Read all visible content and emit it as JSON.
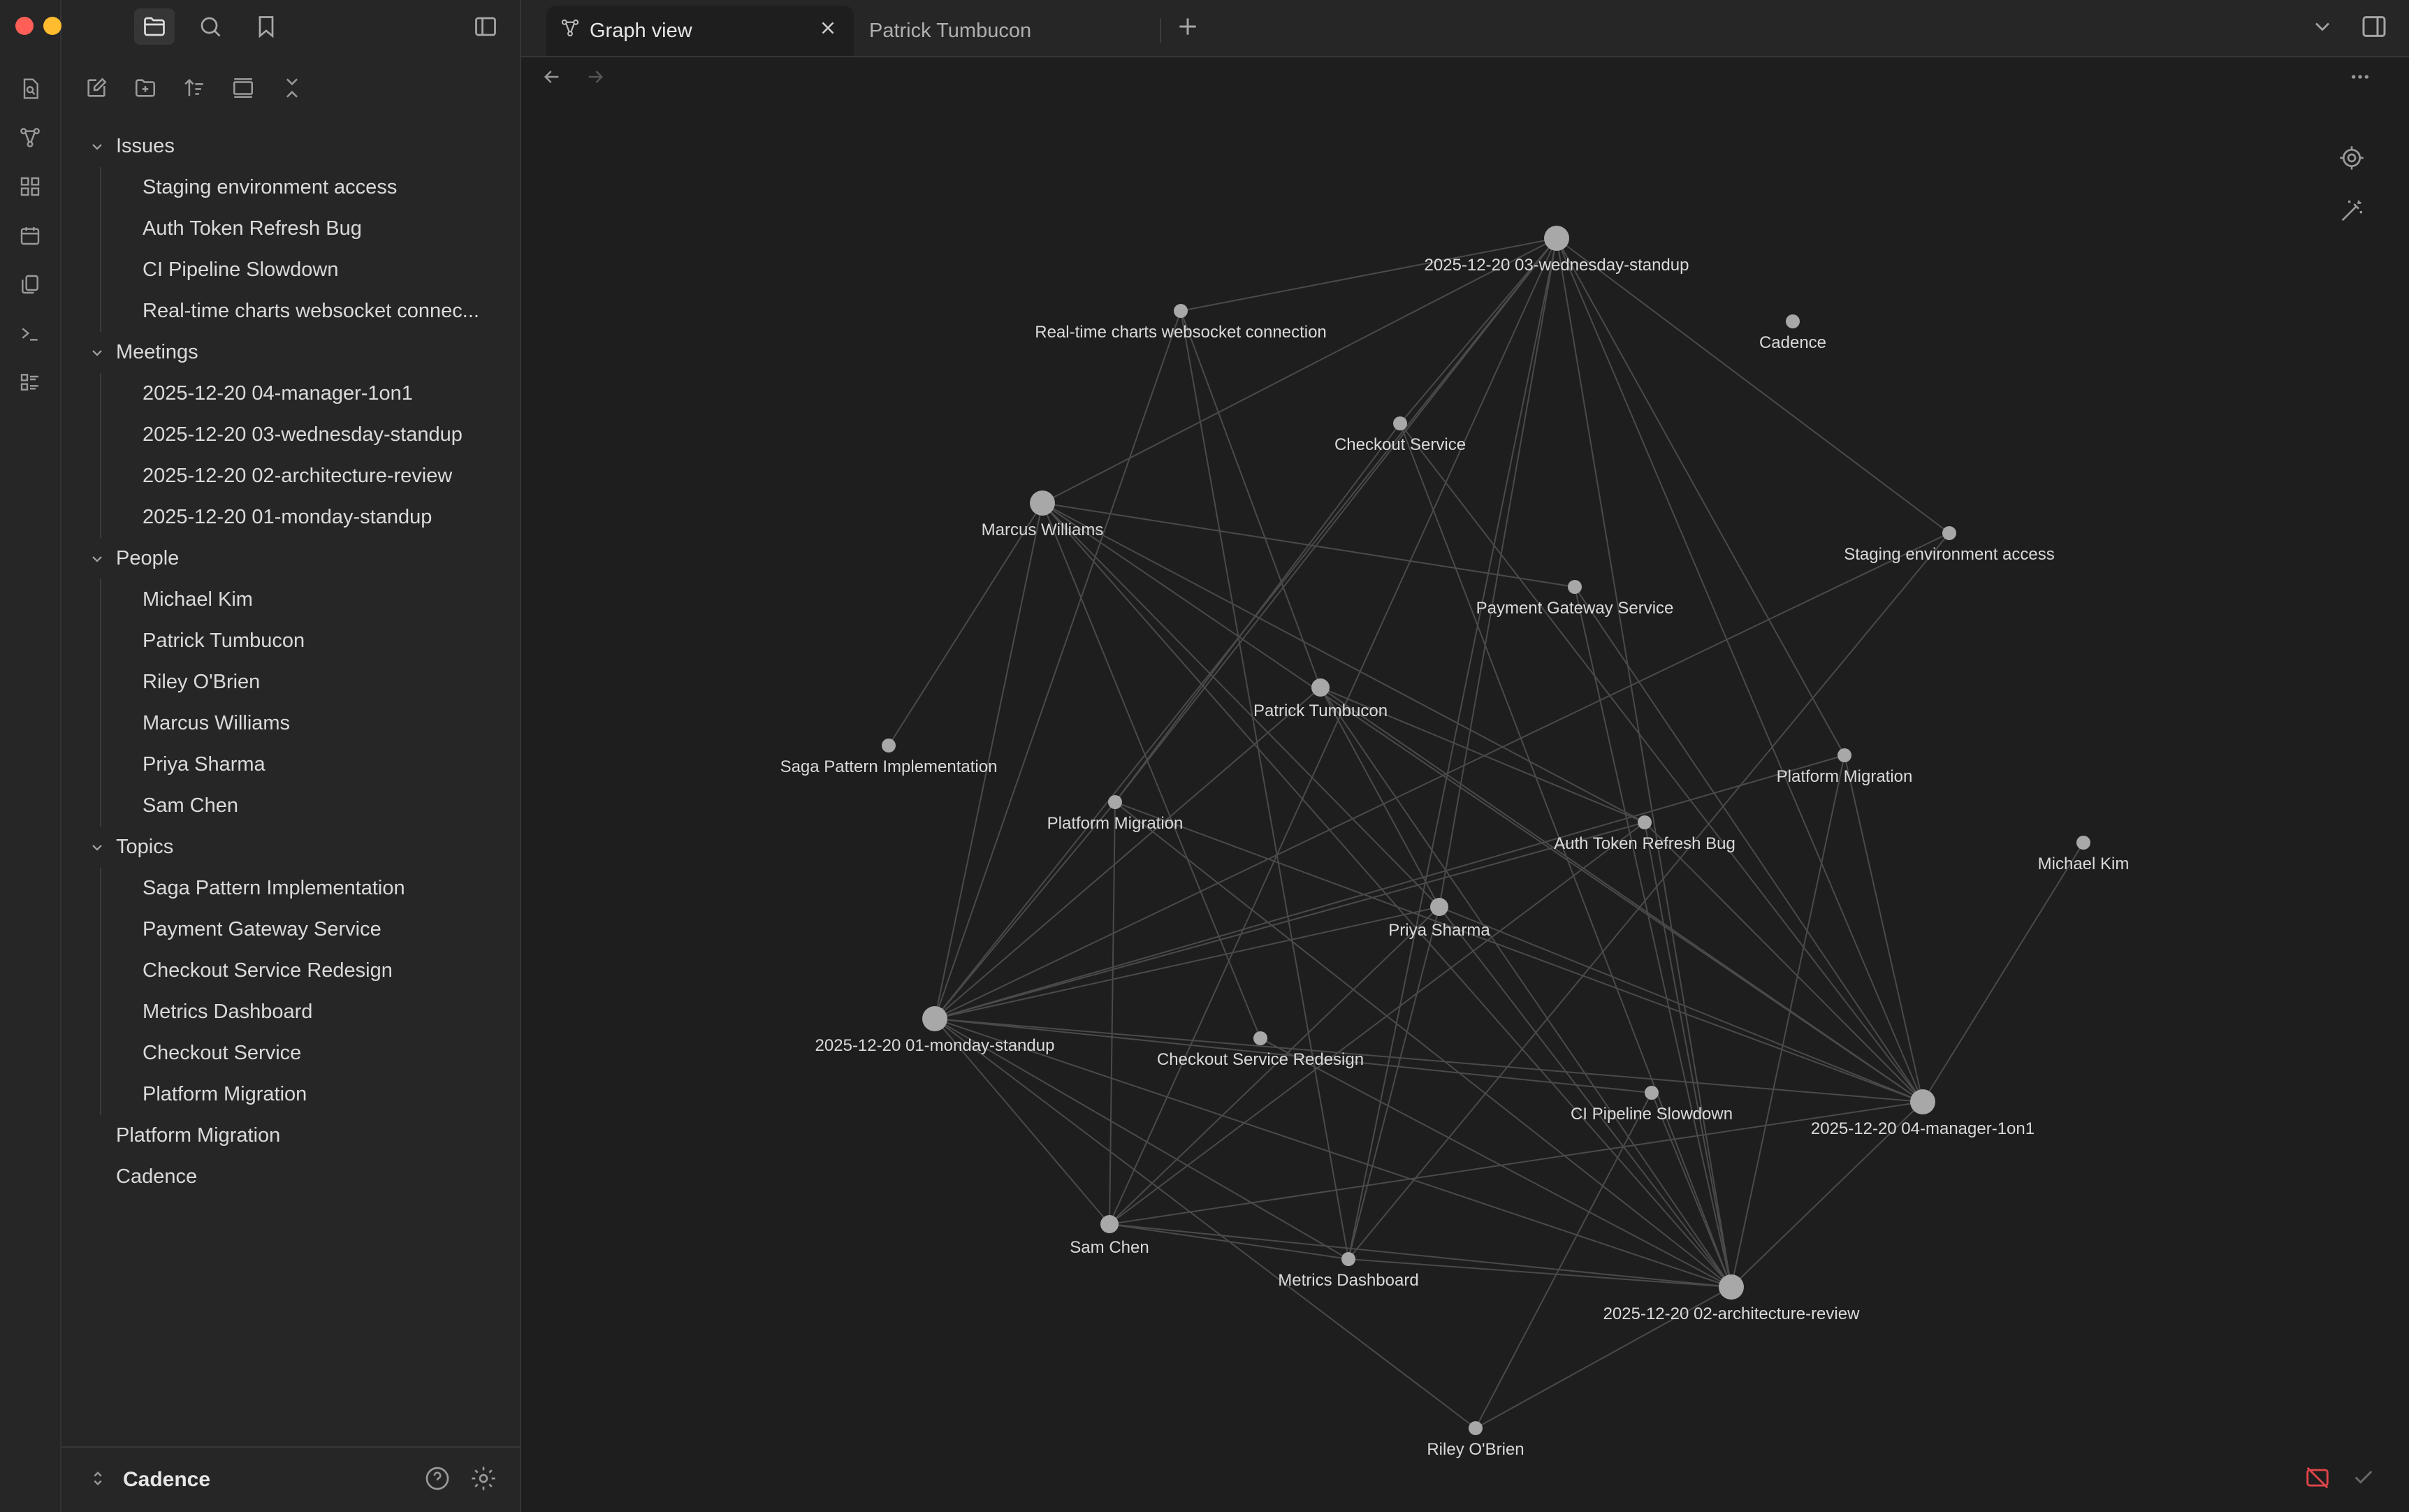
{
  "sidebar": {
    "tree": [
      {
        "type": "folder",
        "label": "Issues",
        "children": [
          "Staging environment access",
          "Auth Token Refresh Bug",
          "CI Pipeline Slowdown",
          "Real-time charts websocket connec..."
        ]
      },
      {
        "type": "folder",
        "label": "Meetings",
        "children": [
          "2025-12-20 04-manager-1on1",
          "2025-12-20 03-wednesday-standup",
          "2025-12-20 02-architecture-review",
          "2025-12-20 01-monday-standup"
        ]
      },
      {
        "type": "folder",
        "label": "People",
        "children": [
          "Michael Kim",
          "Patrick Tumbucon",
          "Riley O'Brien",
          "Marcus Williams",
          "Priya Sharma",
          "Sam Chen"
        ]
      },
      {
        "type": "folder",
        "label": "Topics",
        "children": [
          "Saga Pattern Implementation",
          "Payment Gateway Service",
          "Checkout Service Redesign",
          "Metrics Dashboard",
          "Checkout Service",
          "Platform Migration"
        ]
      },
      {
        "type": "file",
        "label": "Platform Migration"
      },
      {
        "type": "file",
        "label": "Cadence"
      }
    ],
    "vault_name": "Cadence"
  },
  "tabs": [
    {
      "label": "Graph view",
      "active": true
    },
    {
      "label": "Patrick Tumbucon",
      "active": false
    }
  ],
  "graph": {
    "nodes": [
      {
        "id": "wed",
        "label": "2025-12-20 03-wednesday-standup",
        "size": "large"
      },
      {
        "id": "rt",
        "label": "Real-time charts websocket connection",
        "size": "small"
      },
      {
        "id": "cad",
        "label": "Cadence",
        "size": "small"
      },
      {
        "id": "cs",
        "label": "Checkout Service",
        "size": "small"
      },
      {
        "id": "mw",
        "label": "Marcus Williams",
        "size": "large"
      },
      {
        "id": "sea",
        "label": "Staging environment access",
        "size": "small"
      },
      {
        "id": "pgs",
        "label": "Payment Gateway Service",
        "size": "small"
      },
      {
        "id": "pt",
        "label": "Patrick Tumbucon",
        "size": "medium"
      },
      {
        "id": "saga",
        "label": "Saga Pattern Implementation",
        "size": "small"
      },
      {
        "id": "pm1",
        "label": "Platform Migration",
        "size": "small"
      },
      {
        "id": "pm2",
        "label": "Platform Migration",
        "size": "small"
      },
      {
        "id": "atrb",
        "label": "Auth Token Refresh Bug",
        "size": "small"
      },
      {
        "id": "mk",
        "label": "Michael Kim",
        "size": "small"
      },
      {
        "id": "ps",
        "label": "Priya Sharma",
        "size": "medium"
      },
      {
        "id": "mon",
        "label": "2025-12-20 01-monday-standup",
        "size": "large"
      },
      {
        "id": "csr",
        "label": "Checkout Service Redesign",
        "size": "small"
      },
      {
        "id": "cips",
        "label": "CI Pipeline Slowdown",
        "size": "small"
      },
      {
        "id": "mgr",
        "label": "2025-12-20 04-manager-1on1",
        "size": "large"
      },
      {
        "id": "sc",
        "label": "Sam Chen",
        "size": "medium"
      },
      {
        "id": "md",
        "label": "Metrics Dashboard",
        "size": "small"
      },
      {
        "id": "arch",
        "label": "2025-12-20 02-architecture-review",
        "size": "large"
      },
      {
        "id": "rob",
        "label": "Riley O'Brien",
        "size": "small"
      }
    ],
    "edges": [
      [
        "wed",
        "rt"
      ],
      [
        "wed",
        "cs"
      ],
      [
        "wed",
        "mw"
      ],
      [
        "wed",
        "pm2"
      ],
      [
        "wed",
        "sea"
      ],
      [
        "wed",
        "ps"
      ],
      [
        "wed",
        "mon"
      ],
      [
        "wed",
        "sc"
      ],
      [
        "wed",
        "md"
      ],
      [
        "wed",
        "arch"
      ],
      [
        "wed",
        "mgr"
      ],
      [
        "wed",
        "pm1"
      ],
      [
        "rt",
        "pt"
      ],
      [
        "rt",
        "mon"
      ],
      [
        "rt",
        "md"
      ],
      [
        "mw",
        "pgs"
      ],
      [
        "mw",
        "saga"
      ],
      [
        "mw",
        "mon"
      ],
      [
        "mw",
        "atrb"
      ],
      [
        "mw",
        "ps"
      ],
      [
        "mw",
        "mgr"
      ],
      [
        "mw",
        "arch"
      ],
      [
        "mw",
        "csr"
      ],
      [
        "cs",
        "arch"
      ],
      [
        "cs",
        "mgr"
      ],
      [
        "cs",
        "pm1"
      ],
      [
        "sea",
        "mon"
      ],
      [
        "sea",
        "md"
      ],
      [
        "pgs",
        "arch"
      ],
      [
        "pgs",
        "mgr"
      ],
      [
        "pt",
        "atrb"
      ],
      [
        "pt",
        "mgr"
      ],
      [
        "pt",
        "arch"
      ],
      [
        "pt",
        "mon"
      ],
      [
        "pt",
        "ps"
      ],
      [
        "pm1",
        "mon"
      ],
      [
        "pm1",
        "sc"
      ],
      [
        "pm1",
        "arch"
      ],
      [
        "pm1",
        "mgr"
      ],
      [
        "pm2",
        "arch"
      ],
      [
        "pm2",
        "mgr"
      ],
      [
        "pm2",
        "mon"
      ],
      [
        "atrb",
        "mon"
      ],
      [
        "atrb",
        "sc"
      ],
      [
        "atrb",
        "mgr"
      ],
      [
        "atrb",
        "arch"
      ],
      [
        "ps",
        "mon"
      ],
      [
        "ps",
        "mgr"
      ],
      [
        "ps",
        "arch"
      ],
      [
        "ps",
        "sc"
      ],
      [
        "ps",
        "md"
      ],
      [
        "mk",
        "mgr"
      ],
      [
        "mon",
        "mgr"
      ],
      [
        "mon",
        "cips"
      ],
      [
        "mon",
        "arch"
      ],
      [
        "mon",
        "sc"
      ],
      [
        "mon",
        "md"
      ],
      [
        "mon",
        "rob"
      ],
      [
        "csr",
        "arch"
      ],
      [
        "cips",
        "arch"
      ],
      [
        "cips",
        "rob"
      ],
      [
        "mgr",
        "sc"
      ],
      [
        "mgr",
        "arch"
      ],
      [
        "sc",
        "arch"
      ],
      [
        "sc",
        "md"
      ],
      [
        "md",
        "arch"
      ],
      [
        "arch",
        "rob"
      ]
    ]
  }
}
